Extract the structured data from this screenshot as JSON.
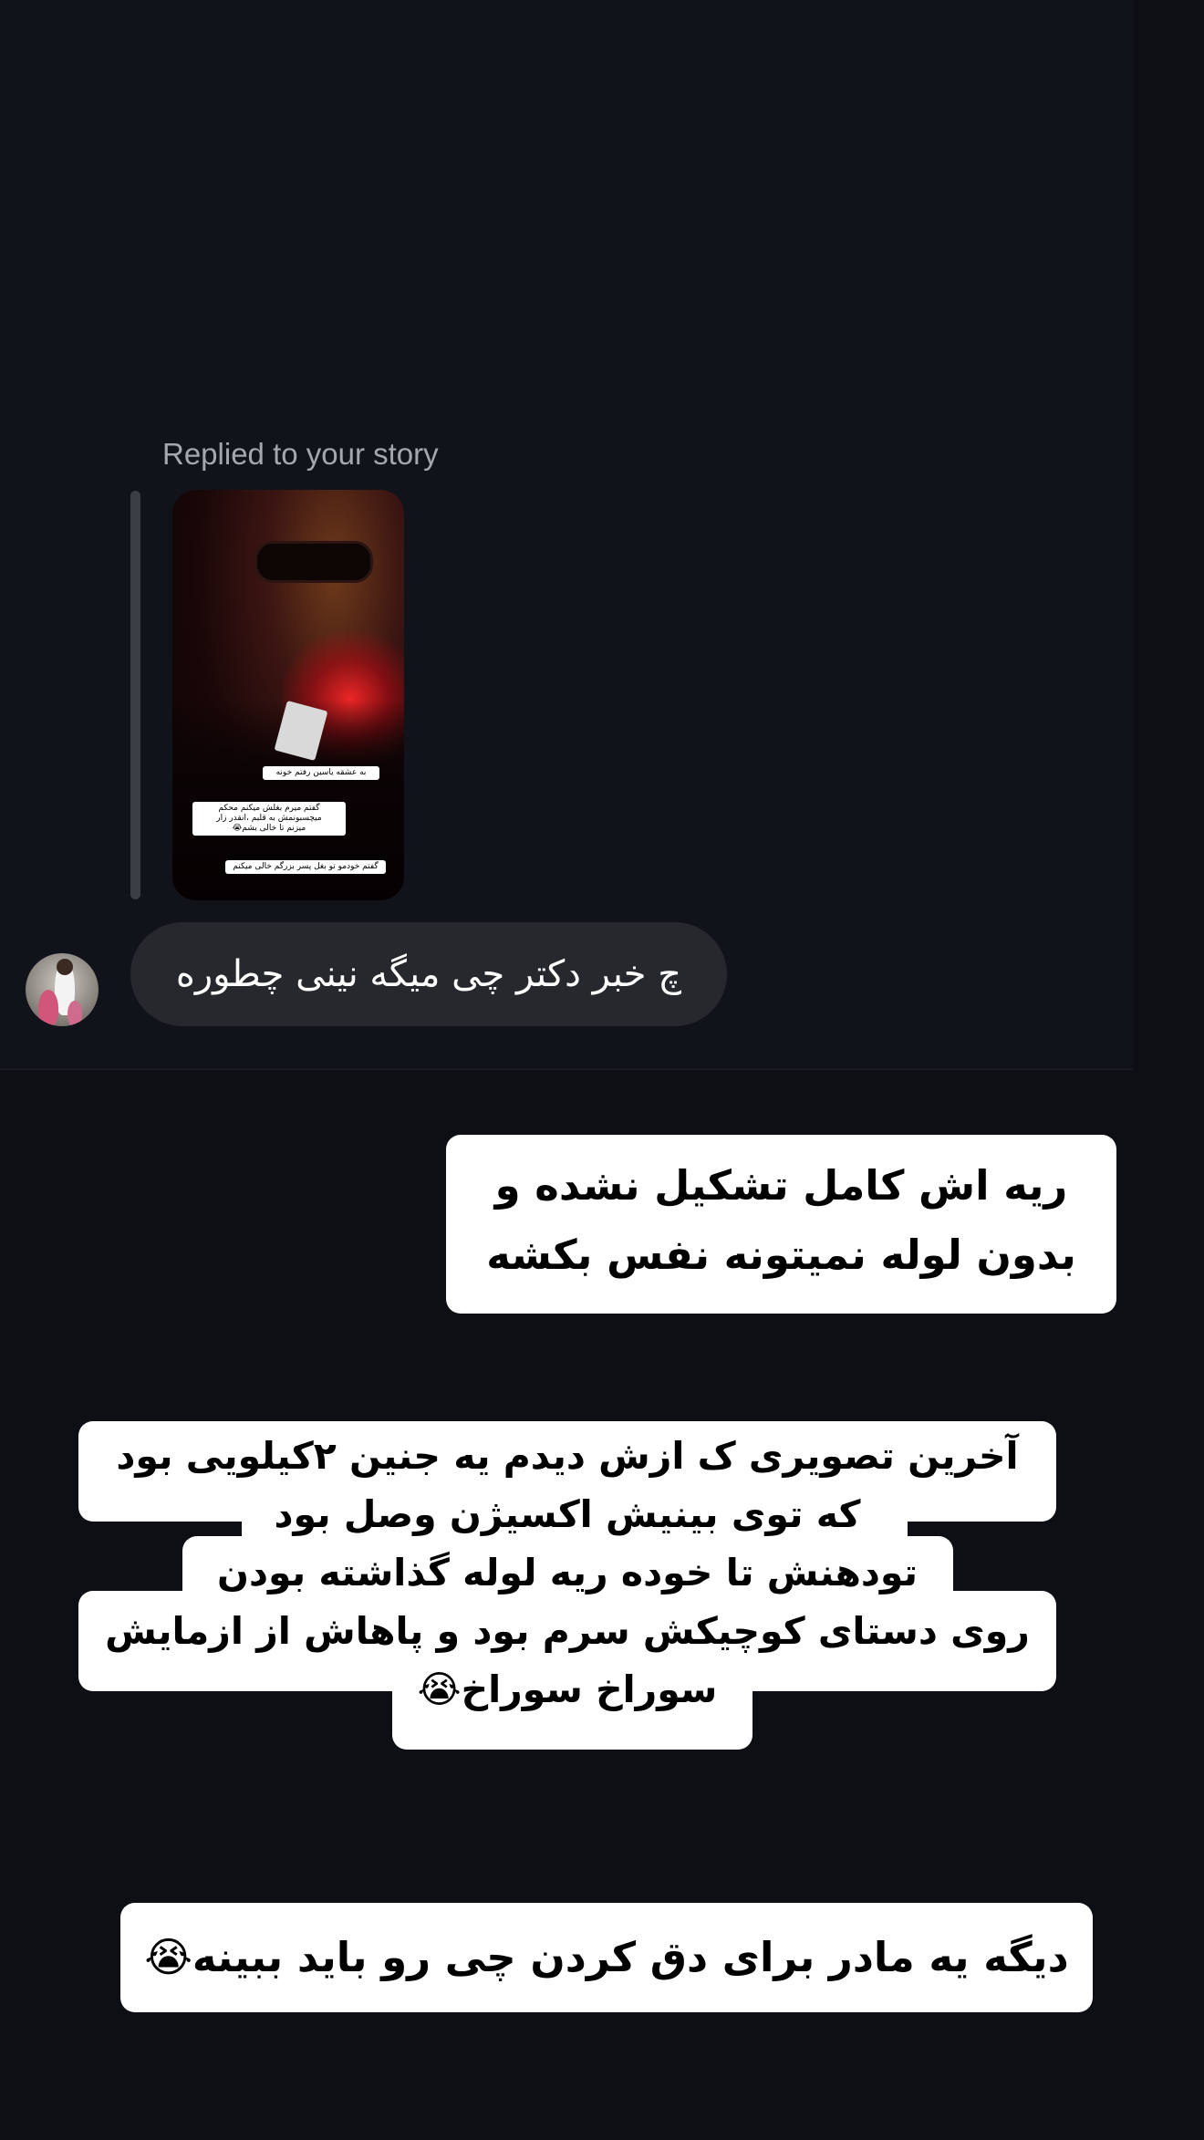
{
  "reply": {
    "label": "Replied to your story",
    "story_captions": [
      "به عشقه یاسین رفتم خونه",
      "گفتم میرم بغلش میکنم محکم\nمیچسبونمش به قلبم ،انقدر زار\nمیزنم تا خالی بشم😭",
      "گفتم خودمو تو بغل پسر بزرگم خالی میکنم"
    ]
  },
  "incoming_message": {
    "text": "چ خبر دکتر چی میگه نینی چطوره"
  },
  "outgoing_captions": {
    "caption1_lines": [
      "ریه اش کامل تشکیل نشده و",
      "بدون لوله نمیتونه نفس بکشه"
    ],
    "caption2_lines": [
      "آخرین تصویری ک ازش دیدم یه جنین ۲کیلویی بود",
      "که توی بینیش اکسیژن وصل بود",
      "تودهنش تا خوده ریه لوله گذاشته بودن",
      "روی دستای کوچیکش سرم بود و پاهاش از ازمایش",
      "سوراخ سوراخ😭"
    ],
    "caption3": "دیگه یه مادر برای دق کردن چی رو باید ببینه😭"
  },
  "colors": {
    "background": "#0d0f14",
    "incoming_bubble": "#26282d",
    "reply_label": "#a3a7ae",
    "caption_box": "#ffffff"
  }
}
